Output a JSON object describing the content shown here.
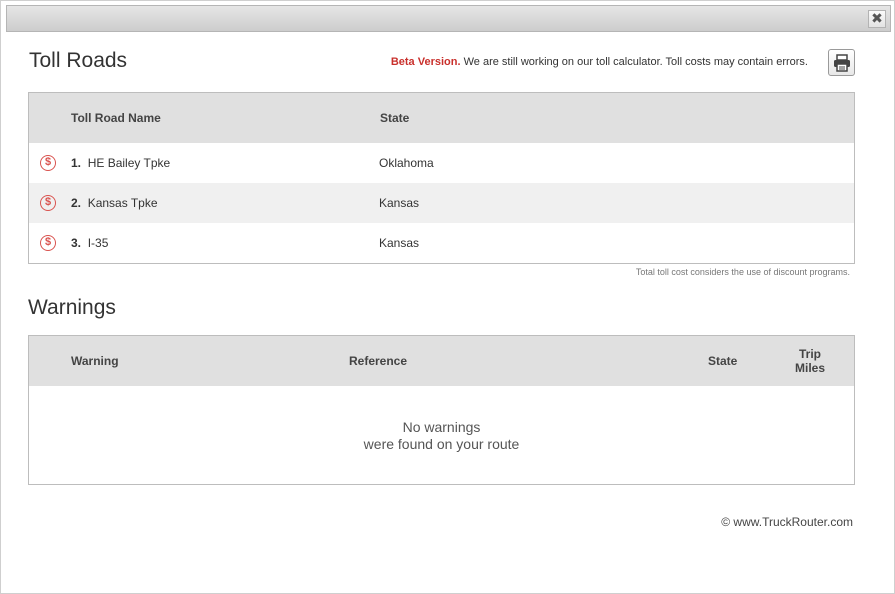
{
  "dialog": {
    "close_label": "✖"
  },
  "tolls": {
    "title": "Toll Roads",
    "beta_label": "Beta Version.",
    "beta_text": " We are still working on our toll calculator. Toll costs may contain errors.",
    "columns": {
      "name": "Toll Road Name",
      "state": "State"
    },
    "rows": [
      {
        "index": "1.",
        "name": "HE Bailey Tpke",
        "state": "Oklahoma"
      },
      {
        "index": "2.",
        "name": "Kansas Tpke",
        "state": "Kansas"
      },
      {
        "index": "3.",
        "name": "I-35",
        "state": "Kansas"
      }
    ],
    "row_icon": "$",
    "discount_note": "Total toll cost considers the use of discount programs."
  },
  "warnings": {
    "title": "Warnings",
    "columns": {
      "warning": "Warning",
      "reference": "Reference",
      "state": "State",
      "trip_miles_1": "Trip",
      "trip_miles_2": "Miles"
    },
    "empty_line1": "No warnings",
    "empty_line2": "were found on your route"
  },
  "footer": {
    "copyright": "© www.TruckRouter.com"
  },
  "colors": {
    "accent_red": "#c9302c",
    "header_bg": "#e0e0e0",
    "alt_row": "#f0f0f0"
  }
}
